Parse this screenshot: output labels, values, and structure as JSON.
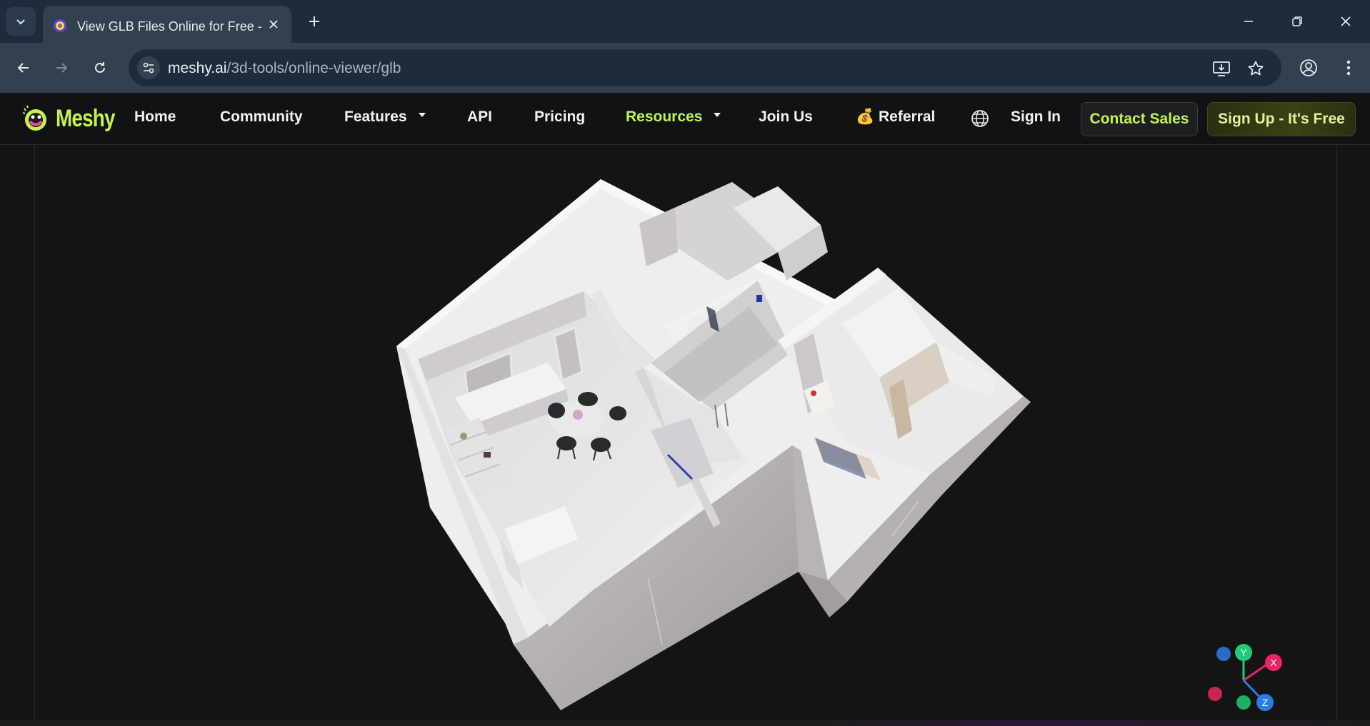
{
  "browser": {
    "tab_title": "View GLB Files Online for Free -",
    "url_domain": "meshy.ai",
    "url_path": "/3d-tools/online-viewer/glb"
  },
  "site": {
    "logo_text": "Meshy",
    "nav": [
      {
        "label": "Home"
      },
      {
        "label": "Community"
      },
      {
        "label": "Features"
      },
      {
        "label": "API"
      },
      {
        "label": "Pricing"
      },
      {
        "label": "Resources"
      },
      {
        "label": "Join Us"
      },
      {
        "label": "💰 Referral"
      },
      {
        "label": "Sign In"
      }
    ],
    "contact_sales": "Contact Sales",
    "sign_up": "Sign Up - It's Free",
    "accent_color": "#c5f24b"
  },
  "viewer": {
    "gizmo": {
      "x": "X",
      "y": "Y",
      "z": "Z"
    }
  }
}
